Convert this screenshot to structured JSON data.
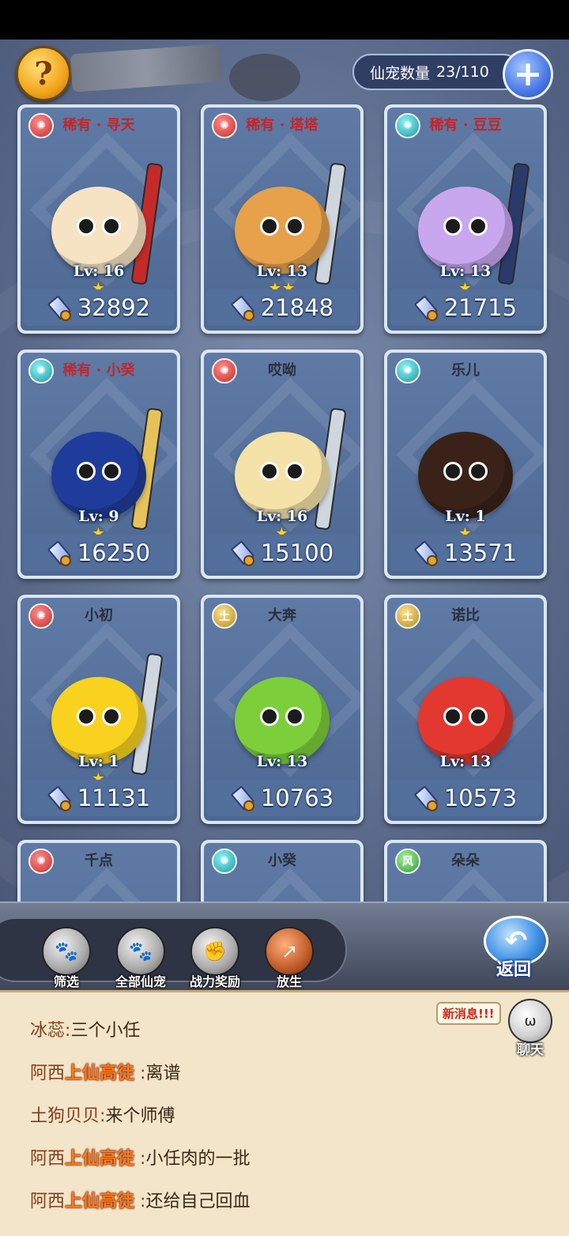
{
  "header": {
    "pet_count_label": "仙宠数量",
    "pet_count_value": "23/110"
  },
  "pets": [
    {
      "name": "稀有 · 寻天",
      "element": "fire",
      "level": "Lv: 16",
      "stars": "★",
      "power": "32892",
      "color": "#f6e3c4",
      "weapon": "#c42a2a"
    },
    {
      "name": "稀有 · 塔塔",
      "element": "fire",
      "level": "Lv: 13",
      "stars": "★★",
      "power": "21848",
      "color": "#e7a14a",
      "weapon": "#cfd6de"
    },
    {
      "name": "稀有 · 豆豆",
      "element": "water",
      "level": "Lv: 13",
      "stars": "★",
      "power": "21715",
      "color": "#c9a7ef",
      "weapon": "#2a3a6a"
    },
    {
      "name": "稀有 · 小癸",
      "element": "water",
      "level": "Lv: 9",
      "stars": "★",
      "power": "16250",
      "color": "#1f3c9b",
      "weapon": "#e6c25a"
    },
    {
      "name": "哎呦",
      "element": "fire",
      "level": "Lv: 16",
      "stars": "★",
      "power": "15100",
      "color": "#f4e2a8",
      "weapon": "#cfd6de"
    },
    {
      "name": "乐儿",
      "element": "water",
      "level": "Lv: 1",
      "stars": "★",
      "power": "13571",
      "color": "#3a2218",
      "weapon": ""
    },
    {
      "name": "小初",
      "element": "fire",
      "level": "Lv: 1",
      "stars": "★",
      "power": "11131",
      "color": "#f8d21f",
      "weapon": "#cfd6de"
    },
    {
      "name": "大奔",
      "element": "earth",
      "level": "Lv: 13",
      "stars": "",
      "power": "10763",
      "color": "#7ccf3a",
      "weapon": ""
    },
    {
      "name": "诺比",
      "element": "earth",
      "level": "Lv: 13",
      "stars": "",
      "power": "10573",
      "color": "#e2382f",
      "weapon": ""
    },
    {
      "name": "千点",
      "element": "fire",
      "level": "",
      "stars": "",
      "power": "",
      "color": "",
      "weapon": ""
    },
    {
      "name": "小癸",
      "element": "water",
      "level": "",
      "stars": "",
      "power": "",
      "color": "",
      "weapon": ""
    },
    {
      "name": "朵朵",
      "element": "wind",
      "level": "",
      "stars": "",
      "power": "",
      "color": "",
      "weapon": ""
    }
  ],
  "toolbar": {
    "filter": "筛选",
    "all_pets": "全部仙宠",
    "power_reward": "战力奖励",
    "release": "放生",
    "back": "返回"
  },
  "chat": {
    "new_message": "新消息!!!",
    "chat_label": "聊天",
    "lines": [
      {
        "name": "冰蕊",
        "title": "",
        "sep": ":",
        "text": "三个小任"
      },
      {
        "name": "阿西",
        "title": "上仙高徒",
        "sep": " :",
        "text": "离谱"
      },
      {
        "name": "土狗贝贝",
        "title": "",
        "sep": ":",
        "text": "来个师傅"
      },
      {
        "name": "阿西",
        "title": "上仙高徒",
        "sep": " :",
        "text": "小任肉的一批"
      },
      {
        "name": "阿西",
        "title": "上仙高徒",
        "sep": " :",
        "text": "还给自己回血"
      }
    ]
  }
}
